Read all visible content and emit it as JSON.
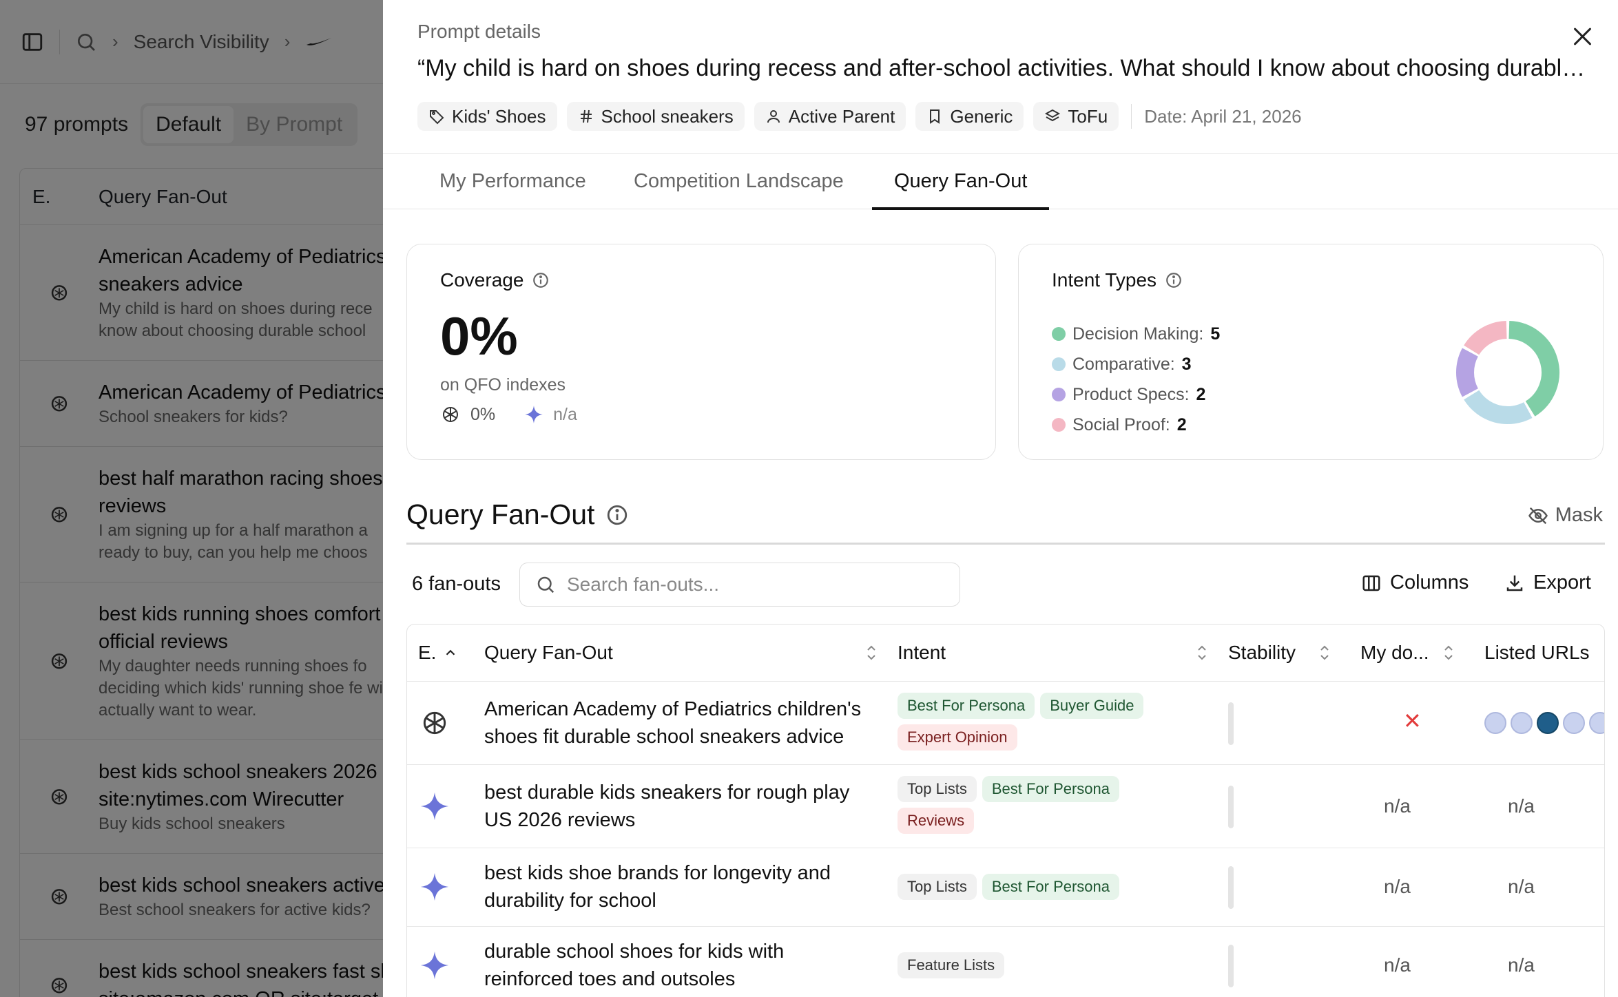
{
  "background": {
    "breadcrumb": [
      "Search Visibility"
    ],
    "prompt_count": "97 prompts",
    "view_toggle": [
      "Default",
      "By Prompt"
    ],
    "list_header": {
      "e_col": "E.",
      "query_col": "Query Fan-Out"
    },
    "rows": [
      {
        "title": "American Academy of Pediatrics sneakers advice",
        "subtitle": "My child is hard on shoes during rece know about choosing durable school",
        "engine": "openai-icon"
      },
      {
        "title": "American Academy of Pediatrics",
        "subtitle": "School sneakers for kids?",
        "engine": "openai-icon"
      },
      {
        "title": "best half marathon racing shoes reviews",
        "subtitle": "I am signing up for a half marathon a ready to buy, can you help me choos",
        "engine": "openai-icon"
      },
      {
        "title": "best kids running shoes comfort official reviews",
        "subtitle": "My daughter needs running shoes fo deciding which kids' running shoe fe will actually want to wear.",
        "engine": "openai-icon"
      },
      {
        "title": "best kids school sneakers 2026 site:nytimes.com Wirecutter",
        "subtitle": "Buy kids school sneakers",
        "engine": "openai-icon"
      },
      {
        "title": "best kids school sneakers active",
        "subtitle": "Best school sneakers for active kids?",
        "engine": "openai-icon"
      },
      {
        "title": "best kids school sneakers fast sl site:amazon.com OR site:target.",
        "subtitle": "",
        "engine": "openai-icon"
      }
    ]
  },
  "drawer": {
    "label": "Prompt details",
    "title": "“My child is hard on shoes during recess and after-school activities. What should I know about choosing durable …",
    "tags": [
      {
        "icon": "tag-icon",
        "label": "Kids' Shoes"
      },
      {
        "icon": "hash-icon",
        "label": "School sneakers"
      },
      {
        "icon": "user-icon",
        "label": "Active Parent"
      },
      {
        "icon": "bookmark-icon",
        "label": "Generic"
      },
      {
        "icon": "layers-icon",
        "label": "ToFu"
      }
    ],
    "date": "Date: April 21, 2026",
    "tabs": [
      "My Performance",
      "Competition Landscape",
      "Query Fan-Out"
    ],
    "active_tab": "Query Fan-Out"
  },
  "coverage": {
    "title": "Coverage",
    "value": "0%",
    "subtitle": "on QFO indexes",
    "openai_value": "0%",
    "gemini_value": "n/a"
  },
  "intent_types": {
    "title": "Intent Types",
    "items": [
      {
        "label": "Decision Making:",
        "count": "5",
        "color": "#7fcea6"
      },
      {
        "label": "Comparative:",
        "count": "3",
        "color": "#b9dbe8"
      },
      {
        "label": "Product Specs:",
        "count": "2",
        "color": "#b5a3e3"
      },
      {
        "label": "Social Proof:",
        "count": "2",
        "color": "#f4b7c3"
      }
    ]
  },
  "chart_data": {
    "type": "pie",
    "categories": [
      "Decision Making",
      "Comparative",
      "Product Specs",
      "Social Proof"
    ],
    "values": [
      5,
      3,
      2,
      2
    ],
    "colors": [
      "#7fcea6",
      "#b9dbe8",
      "#b5a3e3",
      "#f4b7c3"
    ]
  },
  "fanout": {
    "section_title": "Query Fan-Out",
    "mask_label": "Mask",
    "count_label": "6 fan-outs",
    "search_placeholder": "Search fan-outs...",
    "columns_label": "Columns",
    "export_label": "Export",
    "headers": {
      "e": "E.",
      "query": "Query Fan-Out",
      "intent": "Intent",
      "stability": "Stability",
      "mydomain": "My do...",
      "urls": "Listed URLs"
    },
    "rows": [
      {
        "engine": "openai-icon",
        "query": "American Academy of Pediatrics children's shoes fit durable school sneakers advice",
        "intents": [
          {
            "label": "Best For Persona",
            "tone": "green"
          },
          {
            "label": "Buyer Guide",
            "tone": "green"
          },
          {
            "label": "Expert Opinion",
            "tone": "red"
          }
        ],
        "my_domain": "✕",
        "urls": "favicon-list"
      },
      {
        "engine": "gemini-icon",
        "query": "best durable kids sneakers for rough play US 2026 reviews",
        "intents": [
          {
            "label": "Top Lists",
            "tone": "gray"
          },
          {
            "label": "Best For Persona",
            "tone": "green"
          },
          {
            "label": "Reviews",
            "tone": "red"
          }
        ],
        "my_domain": "n/a",
        "urls": "n/a"
      },
      {
        "engine": "gemini-icon",
        "query": "best kids shoe brands for longevity and durability for school",
        "intents": [
          {
            "label": "Top Lists",
            "tone": "gray"
          },
          {
            "label": "Best For Persona",
            "tone": "green"
          }
        ],
        "my_domain": "n/a",
        "urls": "n/a"
      },
      {
        "engine": "gemini-icon",
        "query": "durable school shoes for kids with reinforced toes and outsoles",
        "intents": [
          {
            "label": "Feature Lists",
            "tone": "gray"
          }
        ],
        "my_domain": "n/a",
        "urls": "n/a"
      }
    ]
  }
}
